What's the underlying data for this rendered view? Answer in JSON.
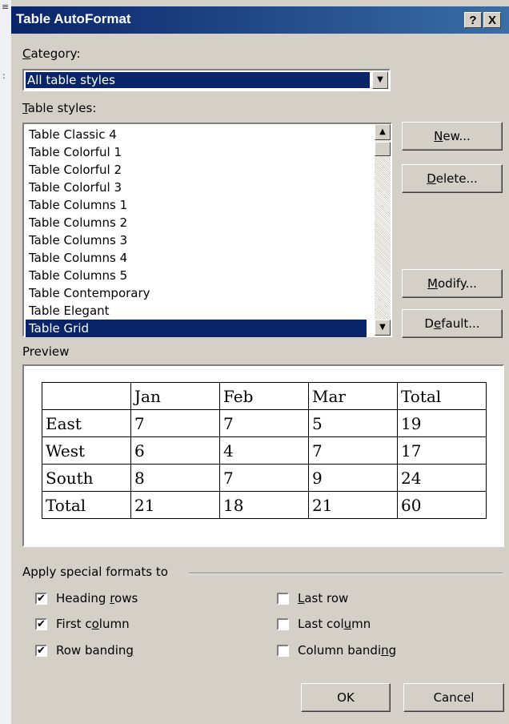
{
  "window": {
    "title": "Table AutoFormat",
    "help_label": "?",
    "close_label": "X"
  },
  "category": {
    "label_prefix": "",
    "label_u": "C",
    "label_rest": "ategory:",
    "value": "All table styles"
  },
  "styles": {
    "label_u": "T",
    "label_rest": "able styles:",
    "items": [
      "Table Classic 4",
      "Table Colorful 1",
      "Table Colorful 2",
      "Table Colorful 3",
      "Table Columns 1",
      "Table Columns 2",
      "Table Columns 3",
      "Table Columns 4",
      "Table Columns 5",
      "Table Contemporary",
      "Table Elegant",
      "Table Grid"
    ],
    "selected": "Table Grid"
  },
  "buttons": {
    "new": {
      "u": "N",
      "rest": "ew..."
    },
    "delete": {
      "u": "D",
      "rest": "elete..."
    },
    "modify": {
      "u": "M",
      "rest": "odify..."
    },
    "default": {
      "pre": "D",
      "u": "e",
      "rest": "fault..."
    },
    "ok": "OK",
    "cancel": "Cancel"
  },
  "preview": {
    "label": "Preview",
    "header": [
      "",
      "Jan",
      "Feb",
      "Mar",
      "Total"
    ],
    "rows": [
      [
        "East",
        "7",
        "7",
        "5",
        "19"
      ],
      [
        "West",
        "6",
        "4",
        "7",
        "17"
      ],
      [
        "South",
        "8",
        "7",
        "9",
        "24"
      ],
      [
        "Total",
        "21",
        "18",
        "21",
        "60"
      ]
    ]
  },
  "special_formats": {
    "label": "Apply special formats to",
    "heading_rows": {
      "pre": "Heading ",
      "u": "r",
      "rest": "ows",
      "checked": true
    },
    "first_column": {
      "pre": "First c",
      "u": "o",
      "rest": "lumn",
      "checked": true
    },
    "row_banding": {
      "pre": "Row bandin",
      "u": "g",
      "rest": "",
      "checked": true
    },
    "last_row": {
      "pre": "",
      "u": "L",
      "rest": "ast row",
      "checked": false
    },
    "last_column": {
      "pre": "Last col",
      "u": "u",
      "rest": "mn",
      "checked": false
    },
    "column_banding": {
      "pre": "Column bandi",
      "u": "n",
      "rest": "g",
      "checked": false
    }
  },
  "colors": {
    "titlebar": "#0a246a",
    "selection": "#0a246a",
    "face": "#d4d0c8"
  }
}
